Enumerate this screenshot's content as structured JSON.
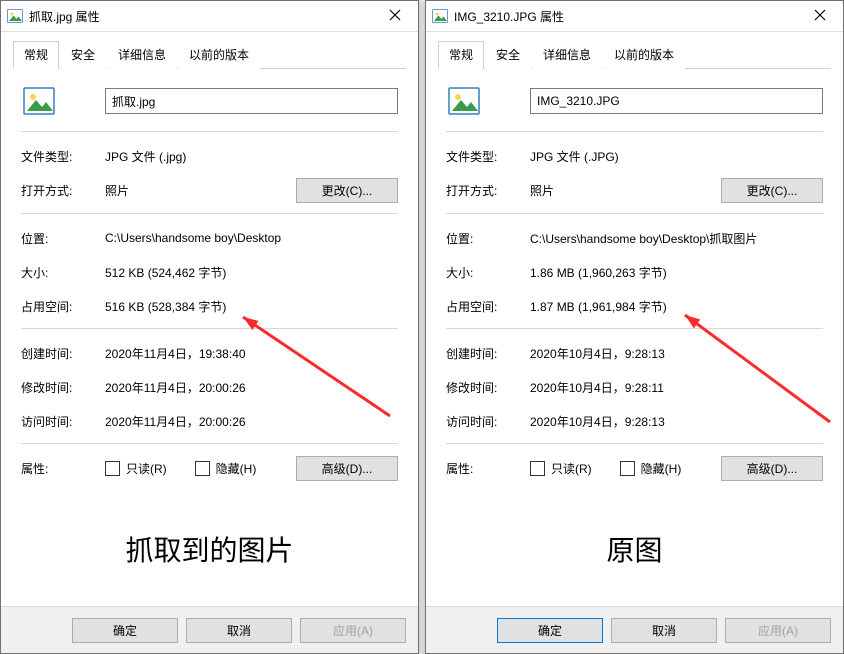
{
  "tabs": {
    "general": "常规",
    "security": "安全",
    "details": "详细信息",
    "previous": "以前的版本"
  },
  "labels": {
    "file_type": "文件类型:",
    "open_with": "打开方式:",
    "change": "更改(C)...",
    "location": "位置:",
    "size": "大小:",
    "size_on_disk": "占用空间:",
    "created": "创建时间:",
    "modified": "修改时间:",
    "accessed": "访问时间:",
    "attributes": "属性:",
    "readonly": "只读(R)",
    "hidden": "隐藏(H)",
    "advanced": "高级(D)...",
    "ok": "确定",
    "cancel": "取消",
    "apply": "应用(A)",
    "properties_suffix": "属性"
  },
  "dialogs": [
    {
      "id": "left",
      "filename": "抓取.jpg",
      "title": "抓取.jpg 属性",
      "file_type": "JPG 文件 (.jpg)",
      "open_with": "照片",
      "location": "C:\\Users\\handsome boy\\Desktop",
      "size": "512 KB (524,462 字节)",
      "size_on_disk": "516 KB (528,384 字节)",
      "created": "2020年11月4日，19:38:40",
      "modified": "2020年11月4日，20:00:26",
      "accessed": "2020年11月4日，20:00:26",
      "caption": "抓取到的图片",
      "ok_primary": false
    },
    {
      "id": "right",
      "filename": "IMG_3210.JPG",
      "title": "IMG_3210.JPG 属性",
      "file_type": "JPG 文件 (.JPG)",
      "open_with": "照片",
      "location": "C:\\Users\\handsome boy\\Desktop\\抓取图片",
      "size": "1.86 MB (1,960,263 字节)",
      "size_on_disk": "1.87 MB (1,961,984 字节)",
      "created": "2020年10月4日，9:28:13",
      "modified": "2020年10月4日，9:28:11",
      "accessed": "2020年10月4日，9:28:13",
      "caption": "原图",
      "ok_primary": true
    }
  ]
}
